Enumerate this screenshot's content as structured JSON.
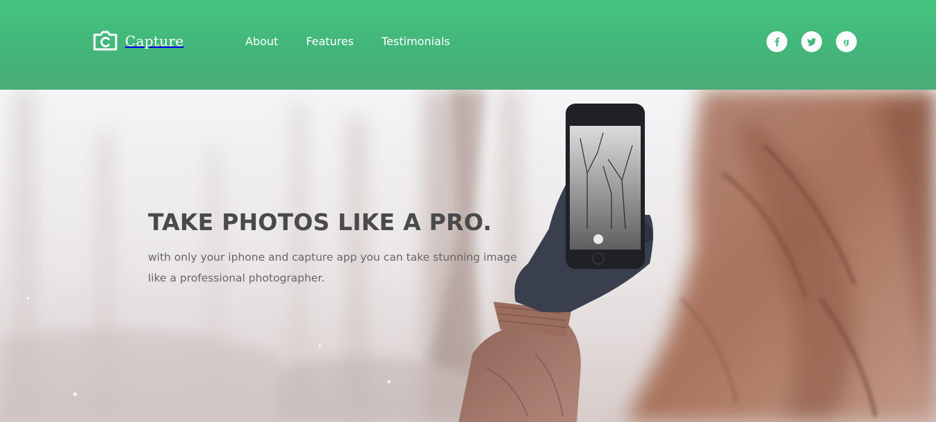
{
  "brand": {
    "name": "Capture",
    "icon": "camera-c-icon",
    "header_color": "#44c27d"
  },
  "nav": {
    "items": [
      {
        "label": "About"
      },
      {
        "label": "Features"
      },
      {
        "label": "Testimonials"
      }
    ]
  },
  "social": [
    {
      "icon": "facebook-icon"
    },
    {
      "icon": "twitter-icon"
    },
    {
      "icon": "google-plus-icon"
    }
  ],
  "hero": {
    "title": "TAKE PHOTOS LIKE A PRO.",
    "subtitle": "with only your iphone and capture app you can take stunning image like a professional photographer.",
    "image": "person-in-winter-forest-taking-photo-with-phone"
  }
}
